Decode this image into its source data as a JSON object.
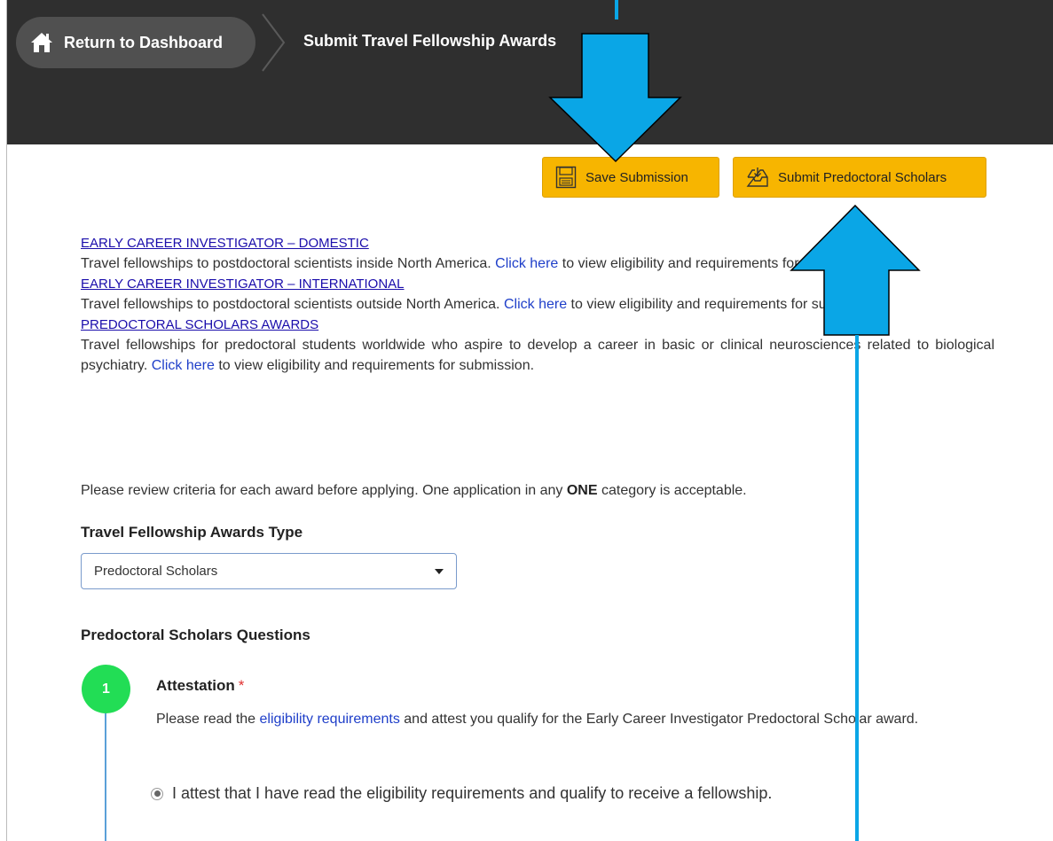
{
  "header": {
    "home_label": "Return to Dashboard",
    "current_page": "Submit Travel Fellowship Awards"
  },
  "actions": {
    "save_label": "Save Submission",
    "submit_label": "Submit Predoctoral Scholars"
  },
  "awards": [
    {
      "title": "EARLY CAREER INVESTIGATOR – DOMESTIC",
      "desc_before": "Travel fellowships to postdoctoral scientists inside North America. ",
      "link": "Click here",
      "desc_after": " to view eligibility and requirements for submission. ."
    },
    {
      "title": "EARLY CAREER INVESTIGATOR – INTERNATIONAL",
      "desc_before": "Travel fellowships to postdoctoral scientists outside North America. ",
      "link": "Click here",
      "desc_after": " to view eligibility and requirements for submission."
    },
    {
      "title": "PREDOCTORAL SCHOLARS AWARDS",
      "desc_before": "Travel fellowships for predoctoral students worldwide who aspire to develop a career in basic or clinical neurosciences related to biological psychiatry. ",
      "link": "Click here",
      "desc_after": " to view eligibility and requirements for submission."
    }
  ],
  "note": {
    "before": "Please review criteria for each award before applying. One application in any ",
    "bold": "ONE",
    "after": " category is acceptable."
  },
  "form": {
    "type_label": "Travel Fellowship Awards Type",
    "type_value": "Predoctoral Scholars",
    "section_title": "Predoctoral Scholars Questions"
  },
  "question": {
    "number": "1",
    "title": "Attestation",
    "required_mark": "*",
    "desc_before": "Please read the ",
    "desc_link": "eligibility requirements",
    "desc_after": " and attest you qualify for the Early Career Investigator Predoctoral Scholar award.",
    "option": "I attest that I have read the eligibility requirements and qualify to receive a fellowship."
  },
  "colors": {
    "topbar": "#2f2f2f",
    "button": "#f7b500",
    "annotation_arrow": "#0aa6e6",
    "step_circle": "#22dd55"
  }
}
